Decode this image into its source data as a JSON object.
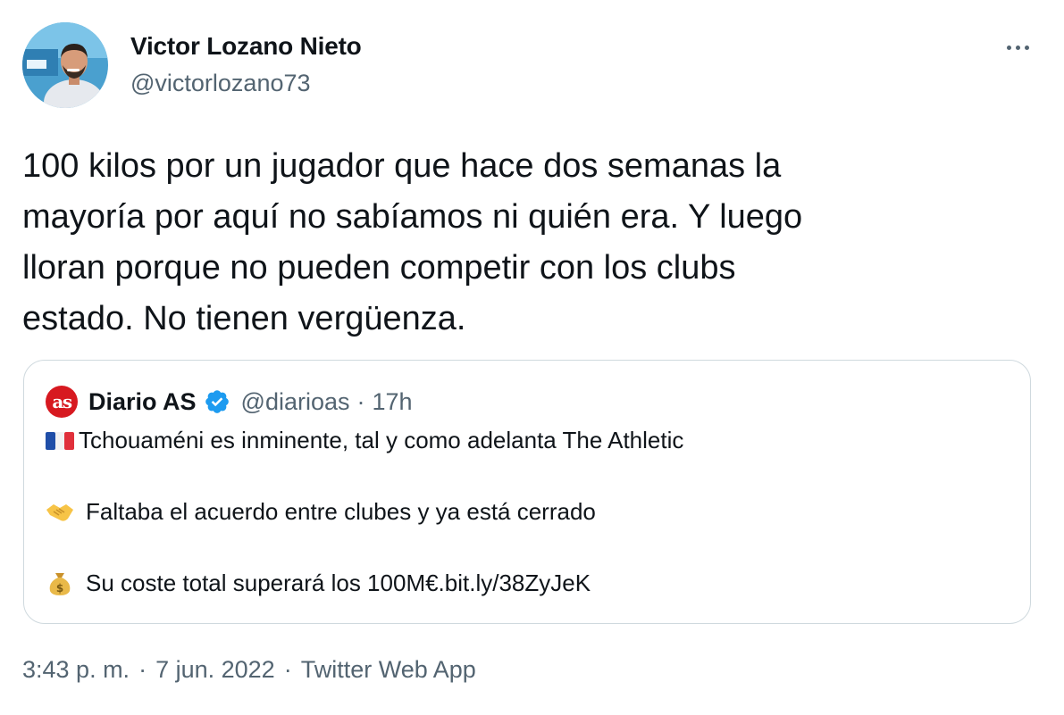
{
  "author": {
    "display_name": "Victor Lozano Nieto",
    "handle": "@victorlozano73"
  },
  "tweet": {
    "lines": [
      "100 kilos por un jugador que hace dos semanas la",
      "mayoría por aquí no sabíamos ni quién era. Y luego",
      "lloran porque no pueden competir con los clubs",
      "estado. No tienen vergüenza."
    ]
  },
  "quote": {
    "logo_text": "as",
    "name": "Diario AS",
    "handle": "@diarioas",
    "separator": "·",
    "time": "17h",
    "lines": [
      {
        "icon": "france-flag-icon",
        "text": "Tchouaméni es inminente, tal y como adelanta The Athletic"
      },
      {
        "icon": "handshake-icon",
        "text": "Faltaba el acuerdo entre clubes y ya está cerrado"
      },
      {
        "icon": "money-bag-icon",
        "text": "Su coste total superará los 100M€. ",
        "link": "bit.ly/38ZyJeK"
      }
    ]
  },
  "meta": {
    "time": "3:43 p. m.",
    "separator": "·",
    "date": "7 jun. 2022",
    "source": "Twitter Web App"
  },
  "colors": {
    "text": "#0f1419",
    "secondary": "#536471",
    "border": "#cfd9de",
    "verified": "#1d9bf0",
    "as_brand": "#d71920"
  }
}
